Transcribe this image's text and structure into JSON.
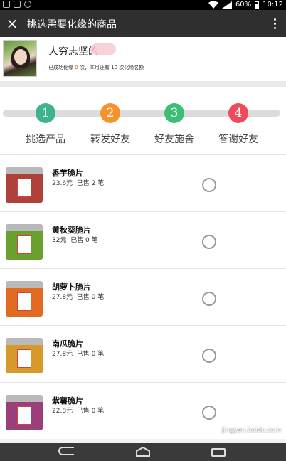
{
  "status_bar": {
    "battery": "60%",
    "time": "10:12"
  },
  "app_bar": {
    "close_icon": "×",
    "title": "挑选需要化缘的商品"
  },
  "profile": {
    "name": "人穷志坚的",
    "desc_before": "已成功化缘",
    "desc_count": "0",
    "desc_after": "次，本月还有 10 次化缘名额"
  },
  "steps": [
    {
      "num": "1",
      "label": "挑选产品",
      "color": "#3db489"
    },
    {
      "num": "2",
      "label": "转发好友",
      "color": "#f5932a"
    },
    {
      "num": "3",
      "label": "好友施舍",
      "color": "#3cbf75"
    },
    {
      "num": "4",
      "label": "答谢好友",
      "color": "#ee4a5a"
    }
  ],
  "products": [
    {
      "name": "香芋脆片",
      "price": "23.6元",
      "sold": "已售 2 笔",
      "color": "#b0403a"
    },
    {
      "name": "黄秋葵脆片",
      "price": "32元",
      "sold": "已售 0 笔",
      "color": "#6aa02e"
    },
    {
      "name": "胡萝卜脆片",
      "price": "27.8元",
      "sold": "已售 0 笔",
      "color": "#e36a22"
    },
    {
      "name": "南瓜脆片",
      "price": "27.8元",
      "sold": "已售 0 笔",
      "color": "#d79a2a"
    },
    {
      "name": "紫薯脆片",
      "price": "22.8元",
      "sold": "已售 0 笔",
      "color": "#9b3f7a"
    }
  ],
  "watermark": "jingyan.baidu.com"
}
